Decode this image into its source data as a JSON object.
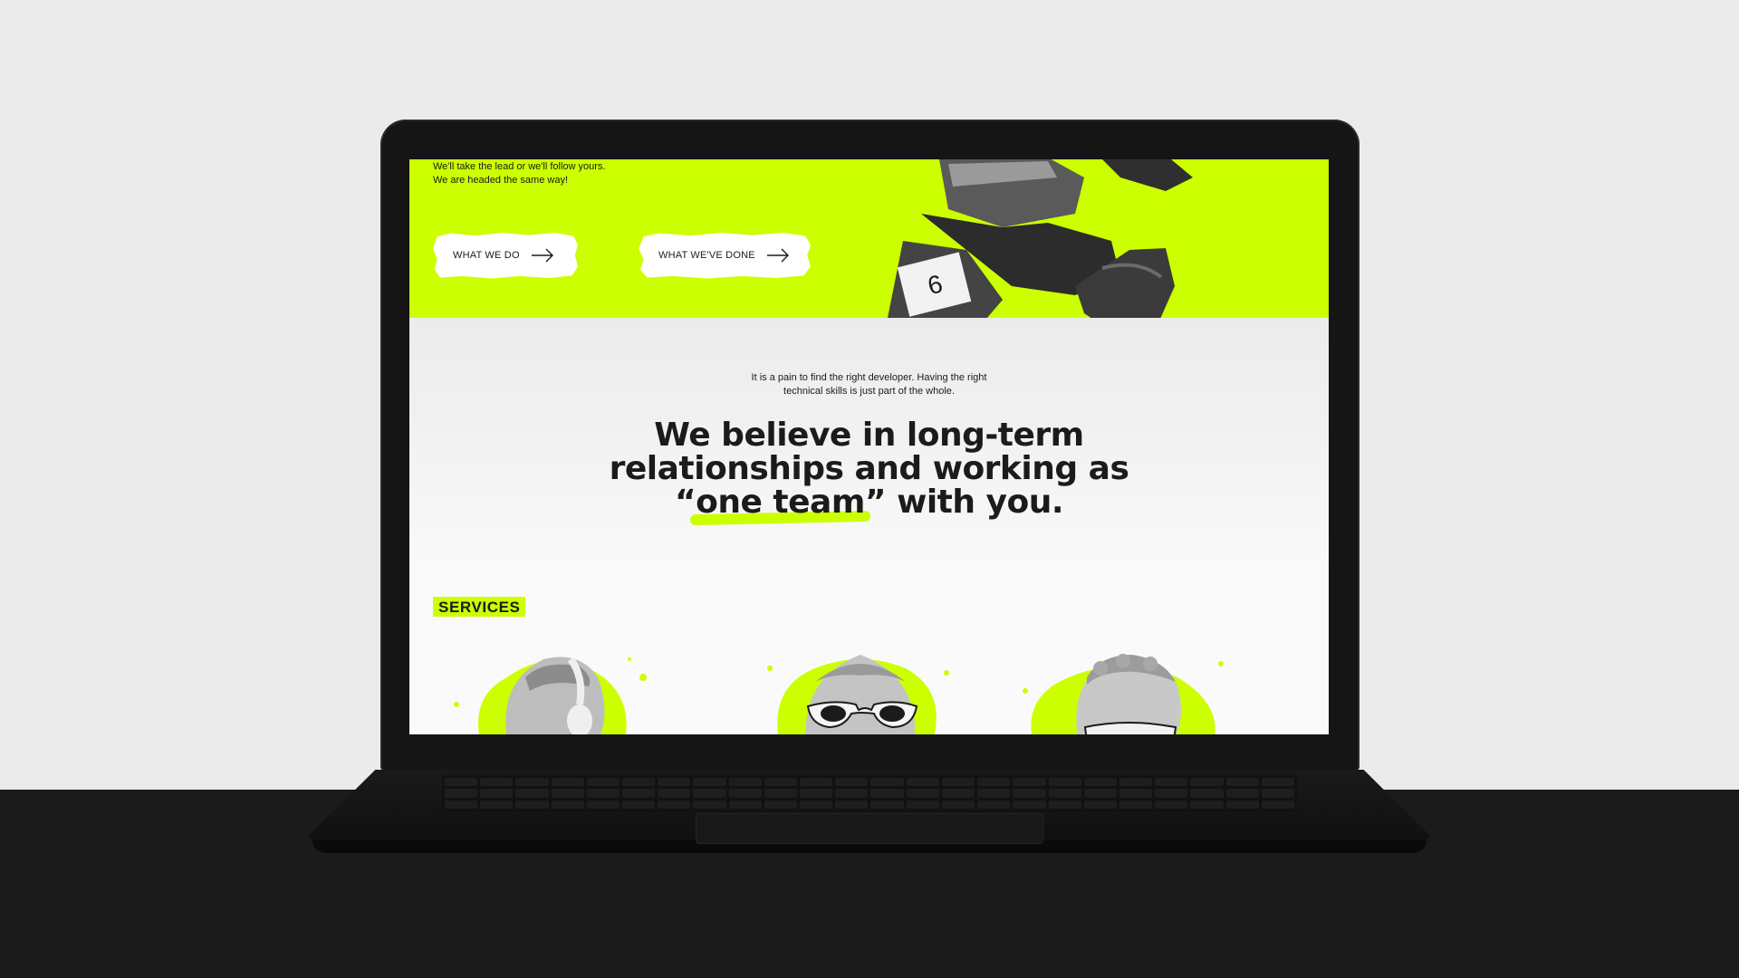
{
  "hero": {
    "tagline_line1": "We'll take the lead or we'll follow yours.",
    "tagline_line2": "We are headed the same way!",
    "cta_primary": "WHAT WE DO",
    "cta_secondary": "WHAT WE'VE DONE",
    "bib_number": "6"
  },
  "mission": {
    "intro_line1": "It is a pain to find the right developer. Having the right",
    "intro_line2": "technical skills is just part of the whole.",
    "headline_line1": "We believe in long-term",
    "headline_line2": "relationships and working as",
    "headline_quote_open": "“",
    "headline_highlight": "one team",
    "headline_rest": "” with you."
  },
  "services": {
    "label": "SERVICES",
    "images": [
      "bust-with-headphones-icon",
      "bust-with-sunglasses-icon",
      "bust-with-face-mask-icon"
    ]
  },
  "colors": {
    "accent": "#ccff00",
    "text": "#1b1b1b",
    "background": "#fafafa",
    "laptop": "#151515",
    "desk": "#1b1b1b"
  }
}
